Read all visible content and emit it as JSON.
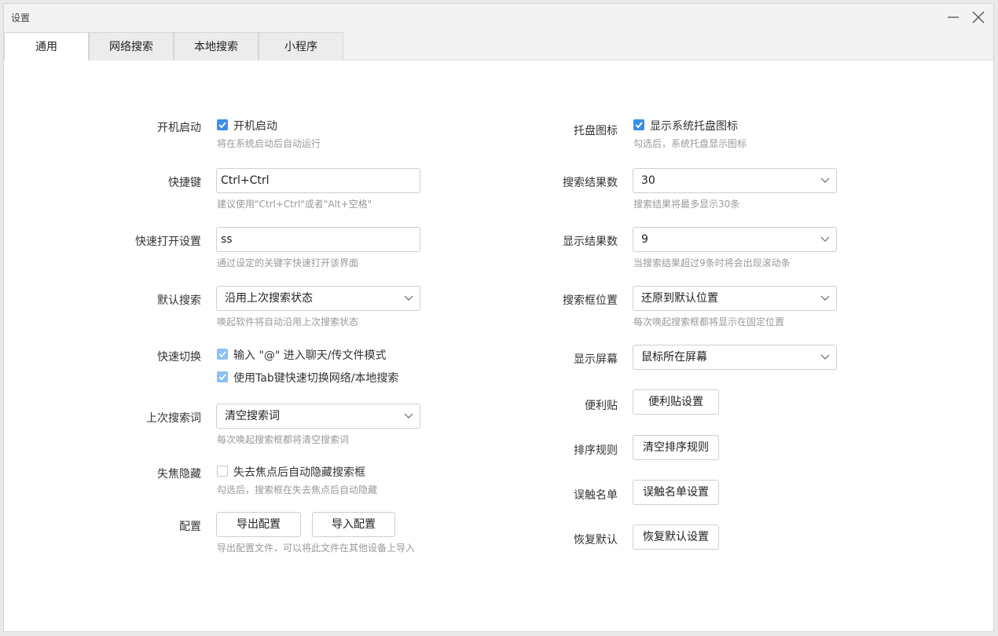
{
  "window": {
    "title": "设置"
  },
  "tabs": [
    {
      "label": "通用"
    },
    {
      "label": "网络搜索"
    },
    {
      "label": "本地搜索"
    },
    {
      "label": "小程序"
    }
  ],
  "left": {
    "autostart": {
      "label": "开机启动",
      "checkbox": "开机启动",
      "checked": true,
      "hint": "将在系统启动后自动运行"
    },
    "hotkey": {
      "label": "快捷键",
      "value": "Ctrl+Ctrl",
      "hint": "建议使用\"Ctrl+Ctrl\"或者\"Alt+空格\""
    },
    "quick_open": {
      "label": "快速打开设置",
      "value": "ss",
      "hint": "通过设定的关键字快速打开该界面"
    },
    "default_search": {
      "label": "默认搜索",
      "value": "沿用上次搜索状态",
      "hint": "唤起软件将自动沿用上次搜索状态"
    },
    "quick_switch": {
      "label": "快速切换",
      "option1": "输入 \"@\" 进入聊天/传文件模式",
      "option2": "使用Tab键快速切换网络/本地搜索"
    },
    "last_query": {
      "label": "上次搜索词",
      "value": "清空搜索词",
      "hint": "每次唤起搜索框都将清空搜索词"
    },
    "blur_hide": {
      "label": "失焦隐藏",
      "checkbox": "失去焦点后自动隐藏搜索框",
      "checked": false,
      "hint": "勾选后，搜索框在失去焦点后自动隐藏"
    },
    "config": {
      "label": "配置",
      "export": "导出配置",
      "import": "导入配置",
      "hint": "导出配置文件，可以将此文件在其他设备上导入"
    }
  },
  "right": {
    "tray": {
      "label": "托盘图标",
      "checkbox": "显示系统托盘图标",
      "checked": true,
      "hint": "勾选后，系统托盘显示图标"
    },
    "result_count": {
      "label": "搜索结果数",
      "value": "30",
      "hint": "搜索结果将最多显示30条"
    },
    "display_count": {
      "label": "显示结果数",
      "value": "9",
      "hint": "当搜索结果超过9条时将会出现滚动条"
    },
    "box_position": {
      "label": "搜索框位置",
      "value": "还原到默认位置",
      "hint": "每次唤起搜索框都将显示在固定位置"
    },
    "screen": {
      "label": "显示屏幕",
      "value": "鼠标所在屏幕"
    },
    "sticky": {
      "label": "便利贴",
      "button": "便利贴设置"
    },
    "sort": {
      "label": "排序规则",
      "button": "清空排序规则"
    },
    "mistouch": {
      "label": "误触名单",
      "button": "误触名单设置"
    },
    "restore": {
      "label": "恢复默认",
      "button": "恢复默认设置"
    }
  },
  "colors": {
    "accent": "#3a8ee6",
    "hint": "#999999"
  }
}
